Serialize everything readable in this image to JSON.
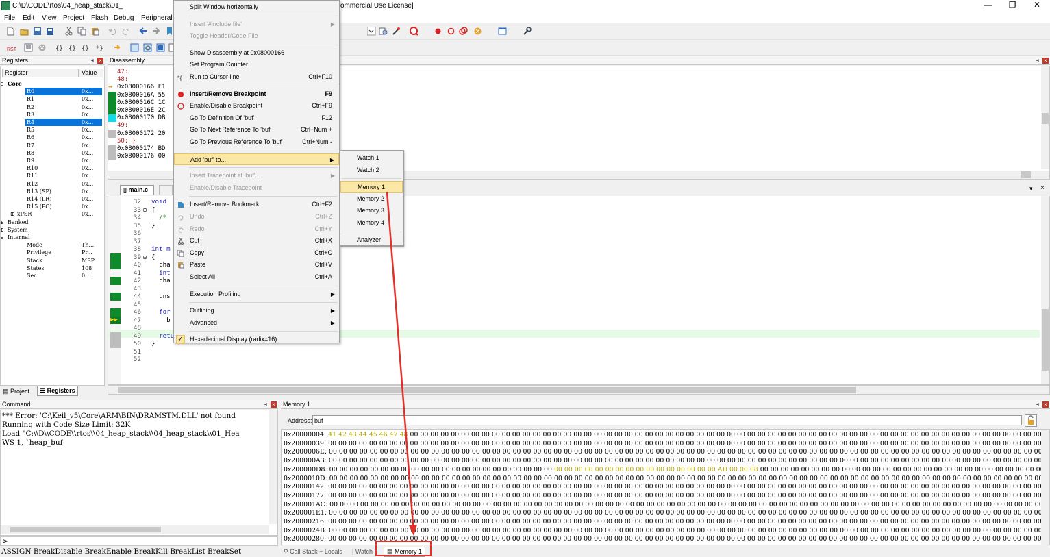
{
  "window": {
    "title": "C:\\D\\CODE\\rtos\\04_heap_stack\\01_",
    "title_suffix": "ommercial Use License]",
    "minimize": "—",
    "restore": "❐",
    "close": "✕"
  },
  "menubar": [
    "File",
    "Edit",
    "View",
    "Project",
    "Flash",
    "Debug",
    "Peripherals"
  ],
  "registers_panel": {
    "title": "Registers",
    "col_register": "Register",
    "col_value": "Value",
    "rows": [
      {
        "indent": 0,
        "tree": "⊟",
        "name": "Core",
        "value": "",
        "bold": true
      },
      {
        "indent": 2,
        "name": "R0",
        "value": "0x...",
        "selected": true
      },
      {
        "indent": 2,
        "name": "R1",
        "value": "0x..."
      },
      {
        "indent": 2,
        "name": "R2",
        "value": "0x..."
      },
      {
        "indent": 2,
        "name": "R3",
        "value": "0x..."
      },
      {
        "indent": 2,
        "name": "R4",
        "value": "0x...",
        "selected": true
      },
      {
        "indent": 2,
        "name": "R5",
        "value": "0x..."
      },
      {
        "indent": 2,
        "name": "R6",
        "value": "0x..."
      },
      {
        "indent": 2,
        "name": "R7",
        "value": "0x..."
      },
      {
        "indent": 2,
        "name": "R8",
        "value": "0x..."
      },
      {
        "indent": 2,
        "name": "R9",
        "value": "0x..."
      },
      {
        "indent": 2,
        "name": "R10",
        "value": "0x..."
      },
      {
        "indent": 2,
        "name": "R11",
        "value": "0x..."
      },
      {
        "indent": 2,
        "name": "R12",
        "value": "0x..."
      },
      {
        "indent": 2,
        "name": "R13 (SP)",
        "value": "0x..."
      },
      {
        "indent": 2,
        "name": "R14 (LR)",
        "value": "0x..."
      },
      {
        "indent": 2,
        "name": "R15 (PC)",
        "value": "0x..."
      },
      {
        "indent": 1,
        "tree": "⊞",
        "name": "xPSR",
        "value": "0x..."
      },
      {
        "indent": 0,
        "tree": "⊞",
        "name": "Banked",
        "value": ""
      },
      {
        "indent": 0,
        "tree": "⊞",
        "name": "System",
        "value": ""
      },
      {
        "indent": 0,
        "tree": "⊟",
        "name": "Internal",
        "value": ""
      },
      {
        "indent": 2,
        "name": "Mode",
        "value": "Th..."
      },
      {
        "indent": 2,
        "name": "Privilege",
        "value": "Pr..."
      },
      {
        "indent": 2,
        "name": "Stack",
        "value": "MSP"
      },
      {
        "indent": 2,
        "name": "States",
        "value": "108"
      },
      {
        "indent": 2,
        "name": "Sec",
        "value": "0...."
      }
    ],
    "tab_project": "Project",
    "tab_registers": "Registers"
  },
  "disassembly": {
    "title": "Disassembly",
    "lines": [
      {
        "text": "    47:",
        "marker": "none"
      },
      {
        "text": "    48:",
        "marker": "none"
      },
      {
        "text": "0x08000166 F1",
        "marker": "arrow"
      },
      {
        "text": "0x0800016A 55",
        "marker": "green"
      },
      {
        "text": "0x0800016C 1C",
        "marker": "green"
      },
      {
        "text": "0x0800016E 2C",
        "marker": "green"
      },
      {
        "text": "0x08000170 DB",
        "marker": "cyan"
      },
      {
        "text": "    49:",
        "marker": "none"
      },
      {
        "text": "0x08000172 20",
        "marker": "gray"
      },
      {
        "text": "    50: }",
        "marker": "none"
      },
      {
        "text": "0x08000174 BD",
        "marker": "gray"
      },
      {
        "text": "0x08000176 00",
        "marker": "gray"
      }
    ]
  },
  "editor": {
    "tab": "main.c",
    "lines": [
      {
        "n": "32",
        "code": "void"
      },
      {
        "n": "33",
        "code": "{",
        "fold": true
      },
      {
        "n": "34",
        "code": "  /*"
      },
      {
        "n": "35",
        "code": "}"
      },
      {
        "n": "36",
        "code": ""
      },
      {
        "n": "37",
        "code": ""
      },
      {
        "n": "38",
        "code": "int m"
      },
      {
        "n": "39",
        "code": "{",
        "fold": true
      },
      {
        "n": "40",
        "code": "  cha"
      },
      {
        "n": "41",
        "code": "  int"
      },
      {
        "n": "42",
        "code": "  cha"
      },
      {
        "n": "43",
        "code": ""
      },
      {
        "n": "44",
        "code": "  uns"
      },
      {
        "n": "45",
        "code": ""
      },
      {
        "n": "46",
        "code": "  for"
      },
      {
        "n": "47",
        "code": "    b"
      },
      {
        "n": "48",
        "code": ""
      },
      {
        "n": "49",
        "code": "  return 0;"
      },
      {
        "n": "50",
        "code": "}"
      },
      {
        "n": "51",
        "code": ""
      },
      {
        "n": "52",
        "code": ""
      }
    ]
  },
  "context_menu": {
    "items": [
      {
        "label": "Split Window horizontally",
        "shortcut": "",
        "bold": false,
        "disabled": false
      },
      {
        "sep": true
      },
      {
        "label": "Insert '#include file'",
        "shortcut": "",
        "disabled": true,
        "submenu": true
      },
      {
        "label": "Toggle Header/Code File",
        "shortcut": "",
        "disabled": true
      },
      {
        "sep": true
      },
      {
        "label": "Show Disassembly at 0x08000166",
        "shortcut": ""
      },
      {
        "label": "Set Program Counter",
        "shortcut": ""
      },
      {
        "label": "Run to Cursor line",
        "shortcut": "Ctrl+F10",
        "icon": "run-to-cursor-icon"
      },
      {
        "sep": true
      },
      {
        "label": "Insert/Remove Breakpoint",
        "shortcut": "F9",
        "bold": true,
        "icon": "breakpoint-icon"
      },
      {
        "label": "Enable/Disable Breakpoint",
        "shortcut": "Ctrl+F9",
        "icon": "breakpoint-outline-icon"
      },
      {
        "label": "Go To Definition Of 'buf'",
        "shortcut": "F12"
      },
      {
        "label": "Go To Next Reference To 'buf'",
        "shortcut": "Ctrl+Num +"
      },
      {
        "label": "Go To Previous Reference To 'buf'",
        "shortcut": "Ctrl+Num -"
      },
      {
        "sep": true
      },
      {
        "label": "Add 'buf' to...",
        "shortcut": "",
        "highlighted": true,
        "submenu": true
      },
      {
        "sep": true
      },
      {
        "label": "Insert Tracepoint at 'buf'...",
        "shortcut": "",
        "disabled": true,
        "submenu": true
      },
      {
        "label": "Enable/Disable Tracepoint",
        "shortcut": "",
        "disabled": true
      },
      {
        "sep": true
      },
      {
        "label": "Insert/Remove Bookmark",
        "shortcut": "Ctrl+F2",
        "icon": "bookmark-icon"
      },
      {
        "label": "Undo",
        "shortcut": "Ctrl+Z",
        "disabled": true,
        "icon": "undo-icon"
      },
      {
        "label": "Redo",
        "shortcut": "Ctrl+Y",
        "disabled": true,
        "icon": "redo-icon"
      },
      {
        "label": "Cut",
        "shortcut": "Ctrl+X",
        "icon": "cut-icon"
      },
      {
        "label": "Copy",
        "shortcut": "Ctrl+C",
        "icon": "copy-icon"
      },
      {
        "label": "Paste",
        "shortcut": "Ctrl+V",
        "icon": "paste-icon"
      },
      {
        "label": "Select All",
        "shortcut": "Ctrl+A"
      },
      {
        "sep": true
      },
      {
        "label": "Execution Profiling",
        "shortcut": "",
        "submenu": true
      },
      {
        "sep": true
      },
      {
        "label": "Outlining",
        "shortcut": "",
        "submenu": true
      },
      {
        "label": "Advanced",
        "shortcut": "",
        "submenu": true
      },
      {
        "sep": true
      },
      {
        "label": "Hexadecimal Display (radix=16)",
        "shortcut": "",
        "checked": true
      }
    ]
  },
  "submenu": {
    "items": [
      {
        "label": "Watch 1"
      },
      {
        "label": "Watch 2"
      },
      {
        "sep": true
      },
      {
        "label": "Memory 1",
        "highlighted": true
      },
      {
        "label": "Memory 2"
      },
      {
        "label": "Memory 3"
      },
      {
        "label": "Memory 4"
      },
      {
        "sep": true
      },
      {
        "label": "Analyzer"
      }
    ]
  },
  "command": {
    "title": "Command",
    "lines": [
      "*** Error: 'C:\\Keil_v5\\Core\\ARM\\BIN\\DRAMSTM.DLL' not found",
      "Running with Code Size Limit: 32K",
      "Load \"C:\\\\D\\\\CODE\\\\rtos\\\\04_heap_stack\\\\04_heap_stack\\\\01_Hea",
      "WS 1, `heap_buf"
    ],
    "prompt": ">",
    "bottom": "ASSIGN BreakDisable BreakEnable BreakKill BreakList BreakSet"
  },
  "memory": {
    "title": "Memory 1",
    "address_label": "Address:",
    "address_value": "buf",
    "rows": [
      {
        "addr": "0x20000004:",
        "bytes": "41 42 43 44 45 46 47 48 00 00 00 00 00 00 00 00 00 00 00 00 00 00 00 00 00 00 00 00 00 00 00 00 00 00 00 00 00 00 00 00 00 00 00 00 00 00 00 00 00 00 00 00 00 00 00 00 00 00 00 00 00 00 00 00 00 00 00 00 00 00 00 00 00 00 00 00 00 00 00 00 00 00",
        "changed": 8
      },
      {
        "addr": "0x20000039:",
        "bytes": "00 00 00 00 00 00 00 00 00 00 00 00 00 00 00 00 00 00 00 00 00 00 00 00 00 00 00 00 00 00 00 00 00 00 00 00 00 00 00 00 00 00 00 00 00 00 00 00 00 00 00 00 00 00 00 00 00 00 00 00 00 00 00 00 00 00 00 00 00 00 00 00 00 00 00 00 00 00 00 00 00 00"
      },
      {
        "addr": "0x2000006E:",
        "bytes": "00 00 00 00 00 00 00 00 00 00 00 00 00 00 00 00 00 00 00 00 00 00 00 00 00 00 00 00 00 00 00 00 00 00 00 00 00 00 00 00 00 00 00 00 00 00 00 00 00 00 00 00 00 00 00 00 00 00 00 00 00 00 00 00 00 00 00 00 00 00 00 00 00 00 00 00 00 00 00 00 00 00"
      },
      {
        "addr": "0x200000A3:",
        "bytes": "00 00 00 00 00 00 00 00 00 00 00 00 00 00 00 00 00 00 00 00 00 00 00 00 00 00 00 00 00 00 00 00 00 00 00 00 00 00 00 00 00 00 00 00 00 00 00 00 00 00 00 00 00 00 00 00 00 00 00 00 00 00 00 00 00 00 00 00 00 00 00 00 00 00 00 00 00 00 00 00 00 00"
      },
      {
        "addr": "0x200000D8:",
        "bytes": "00 00 00 00 00 00 00 00 00 00 00 00 00 00 00 00 00 00 00 00 00 00 00 00 00 00 00 00 00 00 00 00 00 00 00 00 00 00 AD 00 00 08 00 00 00 00 00 00 00 00 00 00 00 00 00 00 00 00 00 00 00 00 00 00 00 00 00 00 00 00 00 00 00 00 00 00 00 00 00 00 00 00",
        "changed_range": [
          22,
          42
        ]
      },
      {
        "addr": "0x2000010D:",
        "bytes": "00 00 00 00 00 00 00 00 00 00 00 00 00 00 00 00 00 00 00 00 00 00 00 00 00 00 00 00 00 00 00 00 00 00 00 00 00 00 00 00 00 00 00 00 00 00 00 00 00 00 00 00 00 00 00 00 00 00 00 00 00 00 00 00 00 00 00 00 00 00 00 00 00 00 00 00 00 00 00 00 00 00"
      },
      {
        "addr": "0x20000142:",
        "bytes": "00 00 00 00 00 00 00 00 00 00 00 00 00 00 00 00 00 00 00 00 00 00 00 00 00 00 00 00 00 00 00 00 00 00 00 00 00 00 00 00 00 00 00 00 00 00 00 00 00 00 00 00 00 00 00 00 00 00 00 00 00 00 00 00 00 00 00 00 00 00 00 00 00 00 00 00 00 00 00 00 00 00"
      },
      {
        "addr": "0x20000177:",
        "bytes": "00 00 00 00 00 00 00 00 00 00 00 00 00 00 00 00 00 00 00 00 00 00 00 00 00 00 00 00 00 00 00 00 00 00 00 00 00 00 00 00 00 00 00 00 00 00 00 00 00 00 00 00 00 00 00 00 00 00 00 00 00 00 00 00 00 00 00 00 00 00 00 00 00 00 00 00 00 00 00 00 00 00"
      },
      {
        "addr": "0x200001AC:",
        "bytes": "00 00 00 00 00 00 00 00 00 00 00 00 00 00 00 00 00 00 00 00 00 00 00 00 00 00 00 00 00 00 00 00 00 00 00 00 00 00 00 00 00 00 00 00 00 00 00 00 00 00 00 00 00 00 00 00 00 00 00 00 00 00 00 00 00 00 00 00 00 00 00 00 00 00 00 00 00 00 00 00 00 00"
      },
      {
        "addr": "0x200001E1:",
        "bytes": "00 00 00 00 00 00 00 00 00 00 00 00 00 00 00 00 00 00 00 00 00 00 00 00 00 00 00 00 00 00 00 00 00 00 00 00 00 00 00 00 00 00 00 00 00 00 00 00 00 00 00 00 00 00 00 00 00 00 00 00 00 00 00 00 00 00 00 00 00 00 00 00 00 00 00 00 00 00 00 00 00 00"
      },
      {
        "addr": "0x20000216:",
        "bytes": "00 00 00 00 00 00 00 00 00 00 00 00 00 00 00 00 00 00 00 00 00 00 00 00 00 00 00 00 00 00 00 00 00 00 00 00 00 00 00 00 00 00 00 00 00 00 00 00 00 00 00 00 00 00 00 00 00 00 00 00 00 00 00 00 00 00 00 00 00 00 00 00 00 00 00 00 00 00 00 00 00 00"
      },
      {
        "addr": "0x2000024B:",
        "bytes": "00 00 00 00 00 00 00 00 00 00 00 00 00 00 00 00 00 00 00 00 00 00 00 00 00 00 00 00 00 00 00 00 00 00 00 00 00 00 00 00 00 00 00 00 00 00 00 00 00 00 00 00 00 00 00 00 00 00 00 00 00 00 00 00 00 00 00 00 00 00 00 00 00 00 00 00 00 00 00 00 00 00"
      },
      {
        "addr": "0x20000280:",
        "bytes": "00 00 00 00 00 00 00 00 00 00 00 00 00 00 00 00 00 00 00 00 00 00 00 00 00 00 00 00 00 00 00 00 00 00 00 00 00 00 00 00 00 00 00 00 00 00 00 00 00 00 00 00 00 00 00 00 00 00 00 00 00 00 00 00 00 00 00 00 00 00 00 00 00 00 00 00 00 00 00 00 00 00"
      }
    ],
    "tabs": [
      "Call Stack + Locals",
      "Watch 1",
      "Memory 1"
    ]
  },
  "colors": {
    "selection": "#0a73d9",
    "highlight": "#fbe8a6",
    "annotation": "#e0322a",
    "changed_byte": "#b8a800",
    "exec_green": "#0f8a2a"
  }
}
